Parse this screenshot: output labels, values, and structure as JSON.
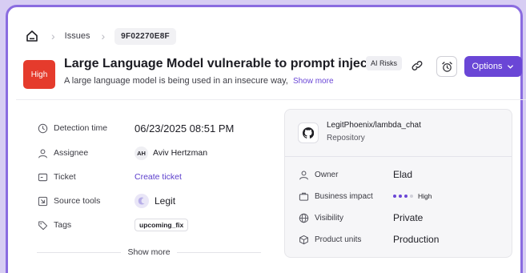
{
  "breadcrumb": {
    "home_icon": "home-icon",
    "items": [
      "Issues",
      "9F02270E8F"
    ]
  },
  "issue": {
    "severity": "High",
    "severity_color": "#e53b2c",
    "title": "Large Language Model vulnerable to prompt injection",
    "subtitle": "A large language model is being used in an insecure way,",
    "show_more_inline": "Show more",
    "tag": "AI Risks"
  },
  "actions": {
    "options_label": "Options",
    "accent": "#6a46d6"
  },
  "details": {
    "detection_time": {
      "label": "Detection time",
      "value": "06/23/2025 08:51 PM"
    },
    "assignee": {
      "label": "Assignee",
      "initials": "AH",
      "value": "Aviv Hertzman"
    },
    "ticket": {
      "label": "Ticket",
      "value": "Create ticket"
    },
    "source_tools": {
      "label": "Source tools",
      "value": "Legit"
    },
    "tags": {
      "label": "Tags",
      "value": "upcoming_fix"
    },
    "show_more": "Show more"
  },
  "repository": {
    "name": "LegitPhoenix/lambda_chat",
    "type": "Repository",
    "owner": {
      "label": "Owner",
      "value": "Elad"
    },
    "business_impact": {
      "label": "Business impact",
      "value": "High",
      "level": 3,
      "max_level": 4
    },
    "visibility": {
      "label": "Visibility",
      "value": "Private"
    },
    "product_units": {
      "label": "Product units",
      "value": "Production"
    }
  }
}
